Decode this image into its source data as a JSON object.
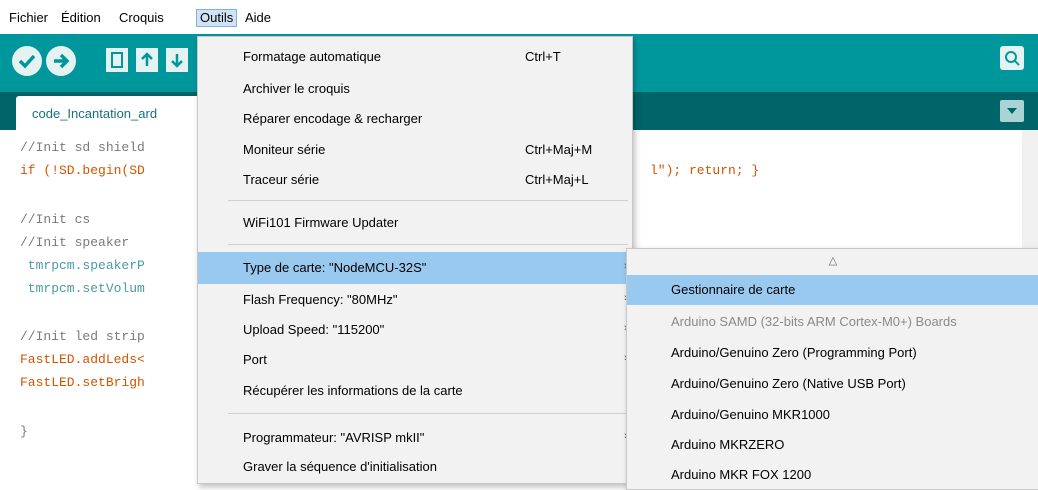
{
  "menubar": {
    "items": [
      "Fichier",
      "Édition",
      "Croquis",
      "Outils",
      "Aide"
    ]
  },
  "toolbar": {
    "icons": [
      "verify-icon",
      "upload-icon",
      "new-icon",
      "open-icon",
      "save-icon",
      "serial-monitor-icon"
    ]
  },
  "tab": {
    "label": "code_Incantation_ard"
  },
  "editor": {
    "lines": [
      "//Init sd shield",
      "if (!SD.begin(SD",
      "//Init cs",
      "//Init speaker",
      " tmrpcm.speakerP",
      " tmrpcm.setVolum",
      "//Init led strip",
      "FastLED.addLeds<",
      "FastLED.setBrigh",
      "}"
    ],
    "line_tail": "l\"); return; }"
  },
  "outils_menu": {
    "items": [
      {
        "label": "Formatage automatique",
        "shortcut": "Ctrl+T"
      },
      {
        "label": "Archiver le croquis",
        "shortcut": ""
      },
      {
        "label": "Réparer encodage & recharger",
        "shortcut": ""
      },
      {
        "label": "Moniteur série",
        "shortcut": "Ctrl+Maj+M"
      },
      {
        "label": "Traceur série",
        "shortcut": "Ctrl+Maj+L"
      },
      {
        "label": "WiFi101 Firmware Updater",
        "shortcut": ""
      },
      {
        "label": "Type de carte: \"NodeMCU-32S\"",
        "shortcut": ""
      },
      {
        "label": "Flash Frequency: \"80MHz\"",
        "shortcut": ""
      },
      {
        "label": "Upload Speed: \"115200\"",
        "shortcut": ""
      },
      {
        "label": "Port",
        "shortcut": ""
      },
      {
        "label": "Récupérer les informations de la carte",
        "shortcut": ""
      },
      {
        "label": "Programmateur: \"AVRISP mkII\"",
        "shortcut": ""
      },
      {
        "label": "Graver la séquence d'initialisation",
        "shortcut": ""
      }
    ],
    "submenu_arrow": "›"
  },
  "board_submenu": {
    "scroll_up": "△",
    "items": [
      "Gestionnaire de carte",
      "Arduino SAMD (32-bits ARM Cortex-M0+) Boards",
      "Arduino/Genuino Zero (Programming Port)",
      "Arduino/Genuino Zero (Native USB Port)",
      "Arduino/Genuino MKR1000",
      "Arduino MKRZERO",
      "Arduino MKR FOX 1200"
    ]
  },
  "colors": {
    "toolbar": "#00979c",
    "tabbar": "#006468",
    "highlight": "#99c9ef"
  }
}
